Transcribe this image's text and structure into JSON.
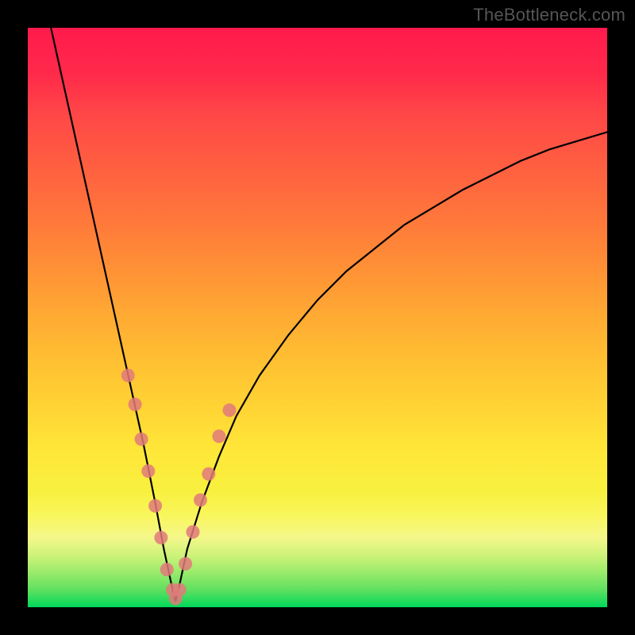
{
  "watermark": "TheBottleneck.com",
  "chart_data": {
    "type": "line",
    "title": "",
    "xlabel": "",
    "ylabel": "",
    "xlim": [
      0,
      100
    ],
    "ylim": [
      0,
      100
    ],
    "notes": "Axes unlabeled; values are relative screen-space percentages estimated from the image. The optimum (curve minimum, near 0) is at x ≈ 25.5.",
    "series": [
      {
        "name": "bottleneck-curve",
        "x": [
          4,
          6,
          8,
          10,
          12,
          14,
          16,
          18,
          20,
          22,
          23.5,
          25,
          25.5,
          26,
          27.5,
          30,
          33,
          36,
          40,
          45,
          50,
          55,
          60,
          65,
          70,
          75,
          80,
          85,
          90,
          95,
          100
        ],
        "y": [
          100,
          91,
          82,
          73,
          64,
          55,
          46,
          37,
          28,
          18,
          10,
          3,
          1,
          3,
          10,
          18,
          26,
          33,
          40,
          47,
          53,
          58,
          62,
          66,
          69,
          72,
          74.5,
          77,
          79,
          80.5,
          82
        ]
      }
    ],
    "markers": {
      "name": "scatter-dots",
      "color": "#e07a7a",
      "x": [
        17.3,
        18.5,
        19.6,
        20.8,
        22.0,
        23.0,
        24.0,
        25.0,
        25.5,
        26.2,
        27.2,
        28.5,
        29.8,
        31.2,
        33.0,
        34.8
      ],
      "y": [
        40.0,
        35.0,
        29.0,
        23.5,
        17.5,
        12.0,
        6.5,
        3.0,
        1.5,
        3.0,
        7.5,
        13.0,
        18.5,
        23.0,
        29.5,
        34.0
      ]
    },
    "gradient_stops": [
      {
        "pct": 0,
        "color": "#ff1a4d"
      },
      {
        "pct": 50,
        "color": "#ffab33"
      },
      {
        "pct": 85,
        "color": "#f8f356"
      },
      {
        "pct": 100,
        "color": "#00d85b"
      }
    ]
  }
}
